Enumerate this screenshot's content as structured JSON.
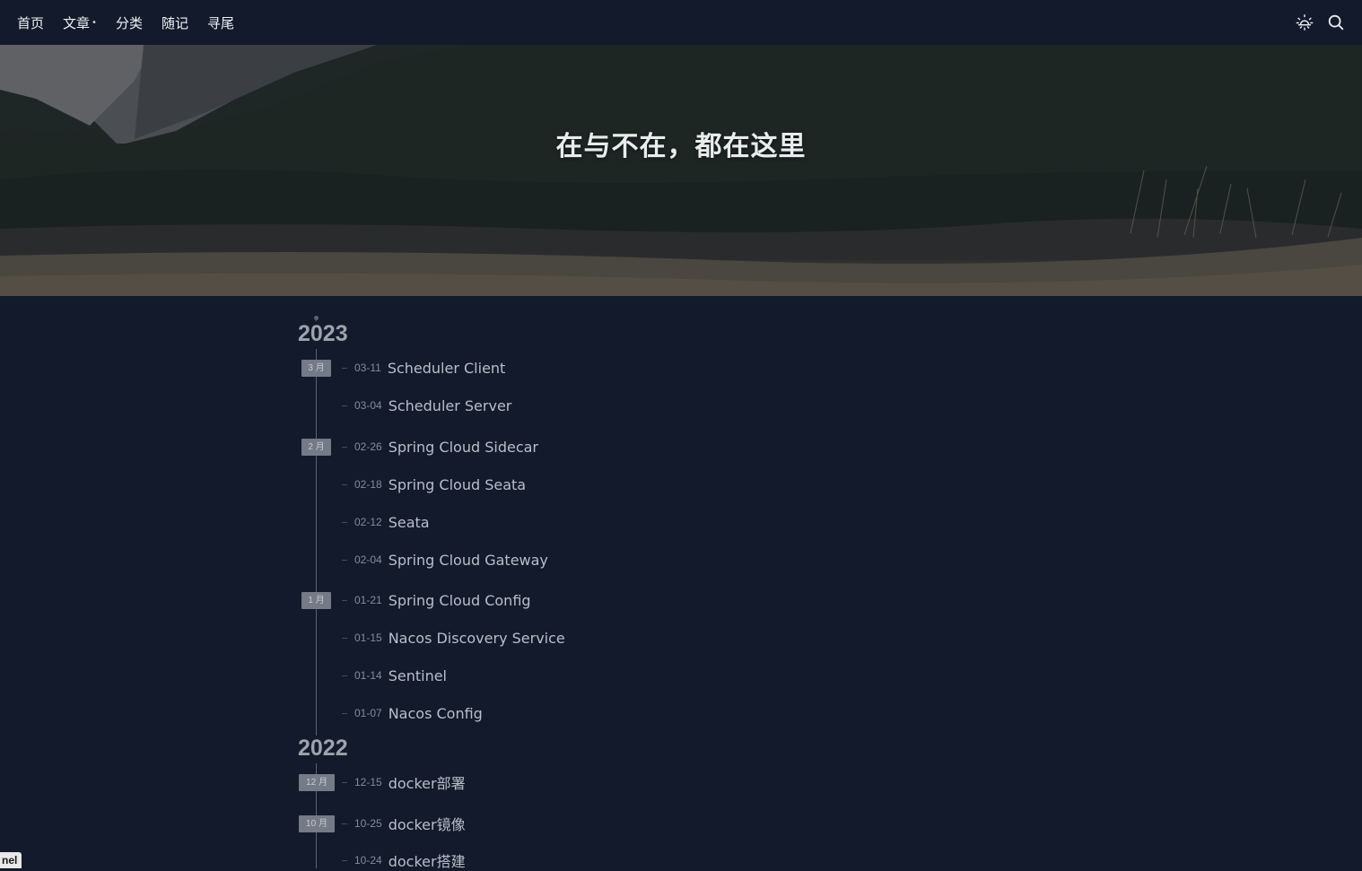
{
  "nav": {
    "items": [
      {
        "label": "首页"
      },
      {
        "label": "文章",
        "caret": "•"
      },
      {
        "label": "分类"
      },
      {
        "label": "随记"
      },
      {
        "label": "寻尾"
      }
    ],
    "icons": [
      "sun-icon",
      "search-icon"
    ]
  },
  "banner": {
    "title": "在与不在，都在这里"
  },
  "timeline": {
    "years": [
      {
        "year": "2023",
        "months": [
          {
            "label": "3 月",
            "posts": [
              {
                "date": "03-11",
                "title": "Scheduler Client"
              },
              {
                "date": "03-04",
                "title": "Scheduler Server"
              }
            ]
          },
          {
            "label": "2 月",
            "posts": [
              {
                "date": "02-26",
                "title": "Spring Cloud Sidecar"
              },
              {
                "date": "02-18",
                "title": "Spring Cloud Seata"
              },
              {
                "date": "02-12",
                "title": "Seata"
              },
              {
                "date": "02-04",
                "title": "Spring Cloud Gateway"
              }
            ]
          },
          {
            "label": "1 月",
            "posts": [
              {
                "date": "01-21",
                "title": "Spring Cloud Config"
              },
              {
                "date": "01-15",
                "title": "Nacos Discovery Service"
              },
              {
                "date": "01-14",
                "title": "Sentinel"
              },
              {
                "date": "01-07",
                "title": "Nacos Config"
              }
            ]
          }
        ]
      },
      {
        "year": "2022",
        "months": [
          {
            "label": "12 月",
            "posts": [
              {
                "date": "12-15",
                "title": "docker部署"
              }
            ]
          },
          {
            "label": "10 月",
            "posts": [
              {
                "date": "10-25",
                "title": "docker镜像"
              },
              {
                "date": "10-24",
                "title": "docker搭建"
              }
            ]
          }
        ]
      }
    ]
  },
  "corner_tag": "nel"
}
